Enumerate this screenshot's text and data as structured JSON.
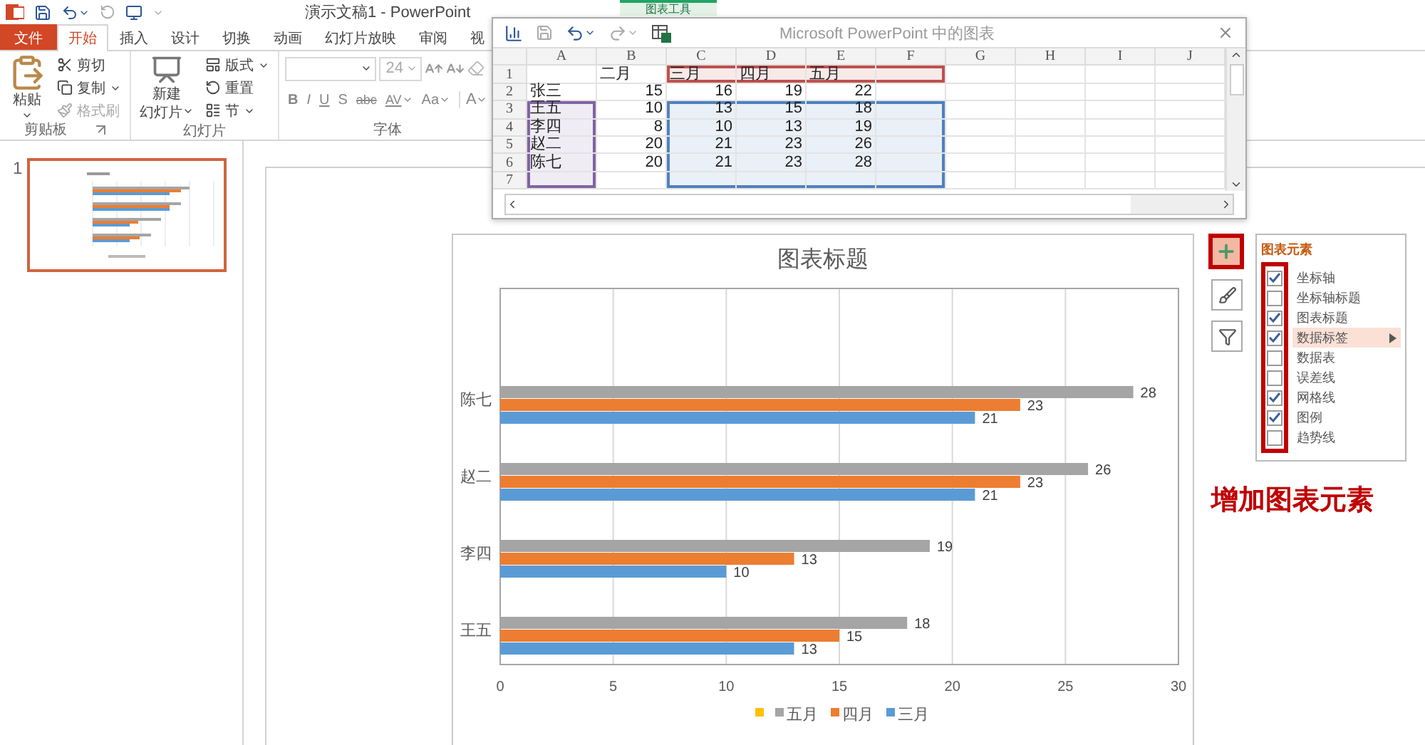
{
  "title_bar": {
    "title": "演示文稿1 - PowerPoint",
    "context_tab": "图表工具"
  },
  "tabs": [
    {
      "label": "文件",
      "kind": "file",
      "selected": false
    },
    {
      "label": "开始",
      "kind": "tab",
      "selected": true
    },
    {
      "label": "插入",
      "kind": "tab",
      "selected": false
    },
    {
      "label": "设计",
      "kind": "tab",
      "selected": false
    },
    {
      "label": "切换",
      "kind": "tab",
      "selected": false
    },
    {
      "label": "动画",
      "kind": "tab",
      "selected": false
    },
    {
      "label": "幻灯片放映",
      "kind": "tab",
      "selected": false
    },
    {
      "label": "审阅",
      "kind": "tab",
      "selected": false
    },
    {
      "label": "视",
      "kind": "tab",
      "selected": false
    }
  ],
  "clipboard": {
    "label": "剪贴板",
    "paste": "粘贴",
    "cut": "剪切",
    "copy": "复制",
    "format_painter": {
      "label": "格式刷",
      "disabled": true
    }
  },
  "slides_group": {
    "label": "幻灯片",
    "new_slide": [
      "新建",
      "幻灯片"
    ],
    "layout": "版式",
    "reset": "重置",
    "section": "节"
  },
  "font": {
    "label": "字体",
    "size": {
      "value": "24",
      "disabled": true
    },
    "format_buttons": [
      {
        "label": "B",
        "kind": "bold",
        "dropdown": false
      },
      {
        "label": "I",
        "kind": "italic",
        "dropdown": false
      },
      {
        "label": "U",
        "kind": "underline",
        "dropdown": false
      },
      {
        "label": "S",
        "kind": "shadow",
        "dropdown": false
      },
      {
        "label": "abc",
        "kind": "strike",
        "dropdown": false
      },
      {
        "label": "AV",
        "kind": "spacing",
        "dropdown": true
      },
      {
        "label": "Aa",
        "kind": "case",
        "dropdown": true
      },
      {
        "label": "A",
        "kind": "color",
        "dropdown": true
      }
    ]
  },
  "thumbnails": [
    {
      "number": "1",
      "selected": true
    }
  ],
  "chart": {
    "chart_data": {
      "type": "bar",
      "orientation": "horizontal",
      "title": "图表标题",
      "categories": [
        "陈七",
        "赵二",
        "李四",
        "王五"
      ],
      "series": [
        {
          "name": "三月",
          "color": "#5b9bd5",
          "values": [
            21,
            21,
            10,
            13
          ],
          "value_labels": [
            "21",
            "21",
            "10",
            "13"
          ]
        },
        {
          "name": "四月",
          "color": "#ed7d31",
          "values": [
            23,
            23,
            13,
            15
          ],
          "value_labels": [
            "23",
            "23",
            "13",
            "15"
          ]
        },
        {
          "name": "五月",
          "color": "#a5a5a5",
          "values": [
            28,
            26,
            19,
            18
          ],
          "value_labels": [
            "28",
            "26",
            "19",
            "18"
          ]
        },
        {
          "color": "#ffc000",
          "values": [
            null,
            null,
            null,
            null
          ]
        }
      ],
      "xlim": [
        0,
        30
      ],
      "xticks": [
        {
          "value": 0,
          "label": "0"
        },
        {
          "value": 5,
          "label": "5"
        },
        {
          "value": 10,
          "label": "10"
        },
        {
          "value": 15,
          "label": "15"
        },
        {
          "value": 20,
          "label": "20"
        },
        {
          "value": 25,
          "label": "25"
        },
        {
          "value": 30,
          "label": "30"
        }
      ],
      "grid": true,
      "legend": true
    }
  },
  "chart_tools": [
    {
      "kind": "elements",
      "selected": true
    },
    {
      "kind": "styles",
      "selected": false
    },
    {
      "kind": "filter",
      "selected": false
    }
  ],
  "chart_elements": {
    "title": "图表元素",
    "items": [
      {
        "label": "坐标轴",
        "checked": true,
        "selected": false
      },
      {
        "label": "坐标轴标题",
        "checked": false,
        "selected": false
      },
      {
        "label": "图表标题",
        "checked": true,
        "selected": false
      },
      {
        "label": "数据标签",
        "checked": true,
        "selected": true
      },
      {
        "label": "数据表",
        "checked": false,
        "selected": false
      },
      {
        "label": "误差线",
        "checked": false,
        "selected": false
      },
      {
        "label": "网格线",
        "checked": true,
        "selected": false
      },
      {
        "label": "图例",
        "checked": true,
        "selected": false
      },
      {
        "label": "趋势线",
        "checked": false,
        "selected": false
      }
    ]
  },
  "annotation": "增加图表元素",
  "data_sheet": {
    "title": "Microsoft PowerPoint 中的图表",
    "columns": [
      "A",
      "B",
      "C",
      "D",
      "E",
      "F",
      "G",
      "H",
      "I",
      "J"
    ],
    "rows": [
      {
        "number": "1",
        "cells": [
          null,
          {
            "text": "二月"
          },
          {
            "text": "三月",
            "color": "#c0504d"
          },
          {
            "text": "四月",
            "color": "#c0504d"
          },
          {
            "text": "五月",
            "color": "#c0504d"
          },
          {
            "color": "#c0504d"
          }
        ]
      },
      {
        "number": "2",
        "cells": [
          {
            "text": "张三"
          },
          {
            "text": "15"
          },
          {
            "text": "16"
          },
          {
            "text": "19"
          },
          {
            "text": "22"
          }
        ]
      },
      {
        "number": "3",
        "cells": [
          {
            "text": "王五",
            "color": "#8064a2"
          },
          {
            "text": "10"
          },
          {
            "text": "13",
            "color": "#4f81bd"
          },
          {
            "text": "15",
            "color": "#4f81bd"
          },
          {
            "text": "18",
            "color": "#4f81bd"
          },
          {
            "color": "#4f81bd"
          }
        ]
      },
      {
        "number": "4",
        "cells": [
          {
            "text": "李四",
            "color": "#8064a2"
          },
          {
            "text": "8"
          },
          {
            "text": "10",
            "color": "#4f81bd"
          },
          {
            "text": "13"
          },
          {
            "text": "19"
          },
          {
            "color": "#4f81bd"
          }
        ]
      },
      {
        "number": "5",
        "cells": [
          {
            "text": "赵二",
            "color": "#8064a2"
          },
          {
            "text": "20"
          },
          {
            "text": "21",
            "color": "#4f81bd"
          },
          {
            "text": "23"
          },
          {
            "text": "26"
          },
          {
            "color": "#4f81bd"
          }
        ]
      },
      {
        "number": "6",
        "cells": [
          {
            "text": "陈七",
            "color": "#8064a2"
          },
          {
            "text": "20"
          },
          {
            "text": "21",
            "color": "#4f81bd"
          },
          {
            "text": "23"
          },
          {
            "text": "28"
          },
          {
            "color": "#4f81bd"
          }
        ]
      },
      {
        "number": "7",
        "cells": [
          {
            "color": "#8064a2"
          },
          null,
          {
            "color": "#4f81bd"
          },
          {
            "color": "#4f81bd"
          },
          {
            "color": "#4f81bd"
          },
          {
            "color": "#4f81bd"
          }
        ]
      }
    ]
  }
}
